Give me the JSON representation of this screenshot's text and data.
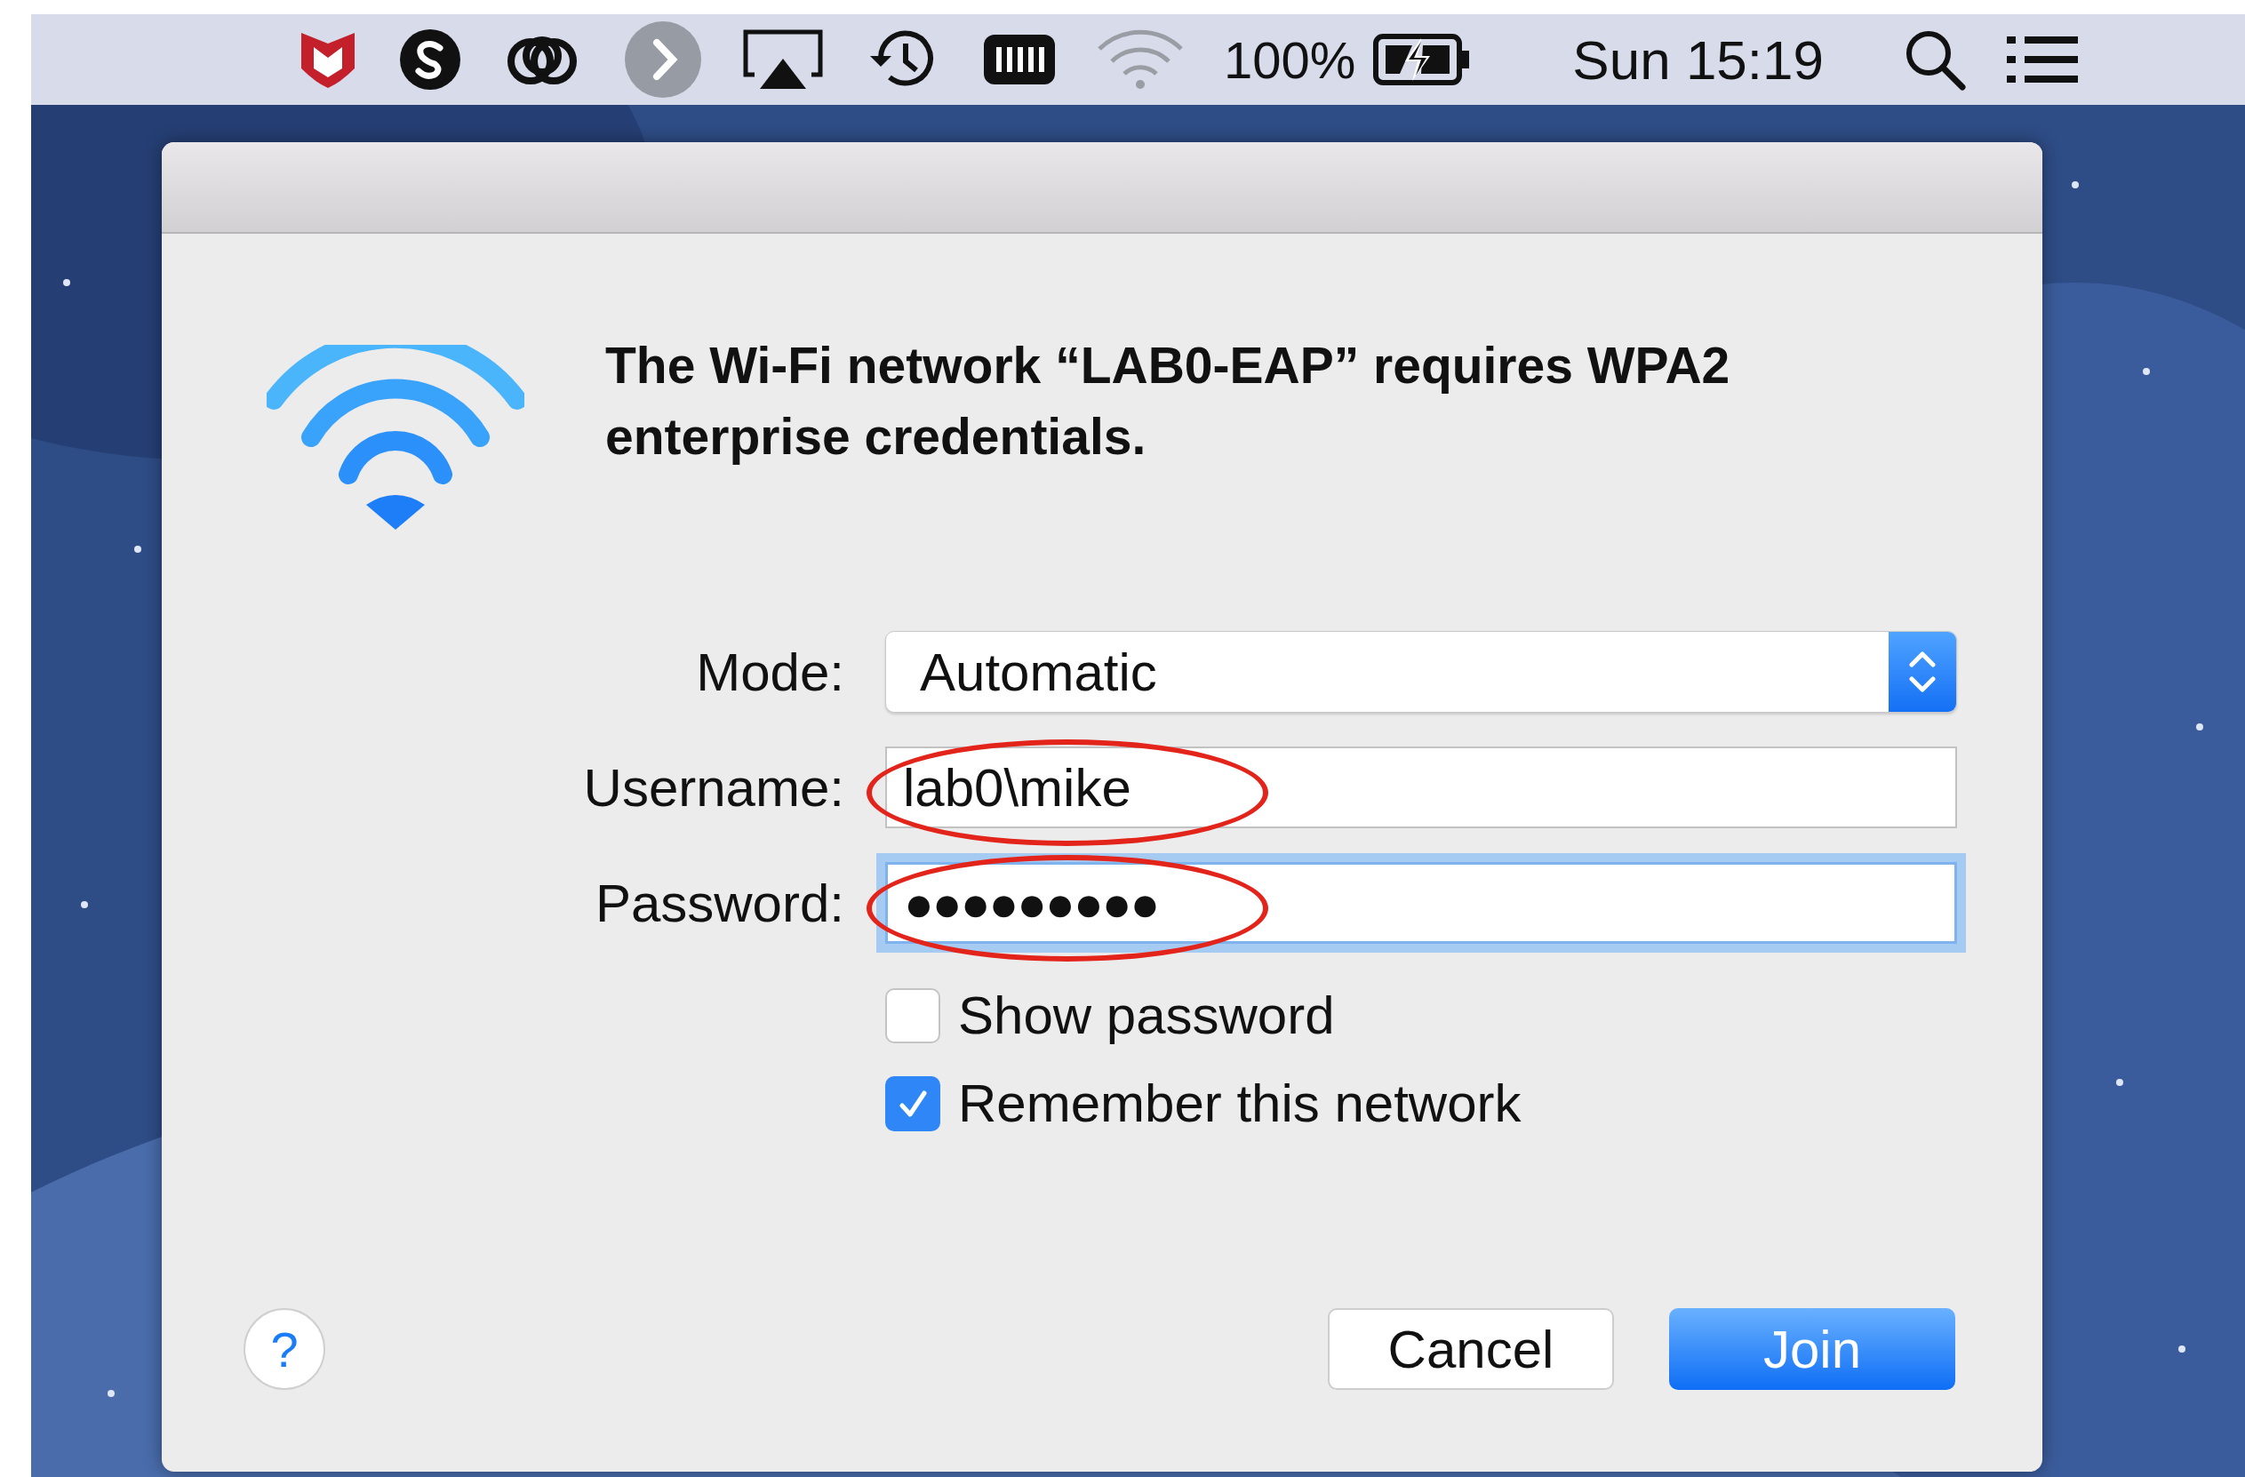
{
  "menu_bar": {
    "battery_percent": "100%",
    "clock": "Sun 15:19"
  },
  "dialog": {
    "message": "The Wi-Fi network “LAB0-EAP” requires WPA2 enterprise credentials.",
    "fields": [
      {
        "kind": "popup",
        "label": "Mode:",
        "value": "Automatic"
      },
      {
        "kind": "text",
        "label": "Username:",
        "value": "lab0\\mike",
        "focused": false,
        "circled": true
      },
      {
        "kind": "password",
        "label": "Password:",
        "value": "●●●●●●●●●",
        "focused": true,
        "circled": true
      }
    ],
    "checkboxes": [
      {
        "label": "Show password",
        "checked": false
      },
      {
        "label": "Remember this network",
        "checked": true
      }
    ],
    "help": "?",
    "buttons": [
      {
        "label": "Cancel",
        "default": false
      },
      {
        "label": "Join",
        "default": true
      }
    ]
  }
}
